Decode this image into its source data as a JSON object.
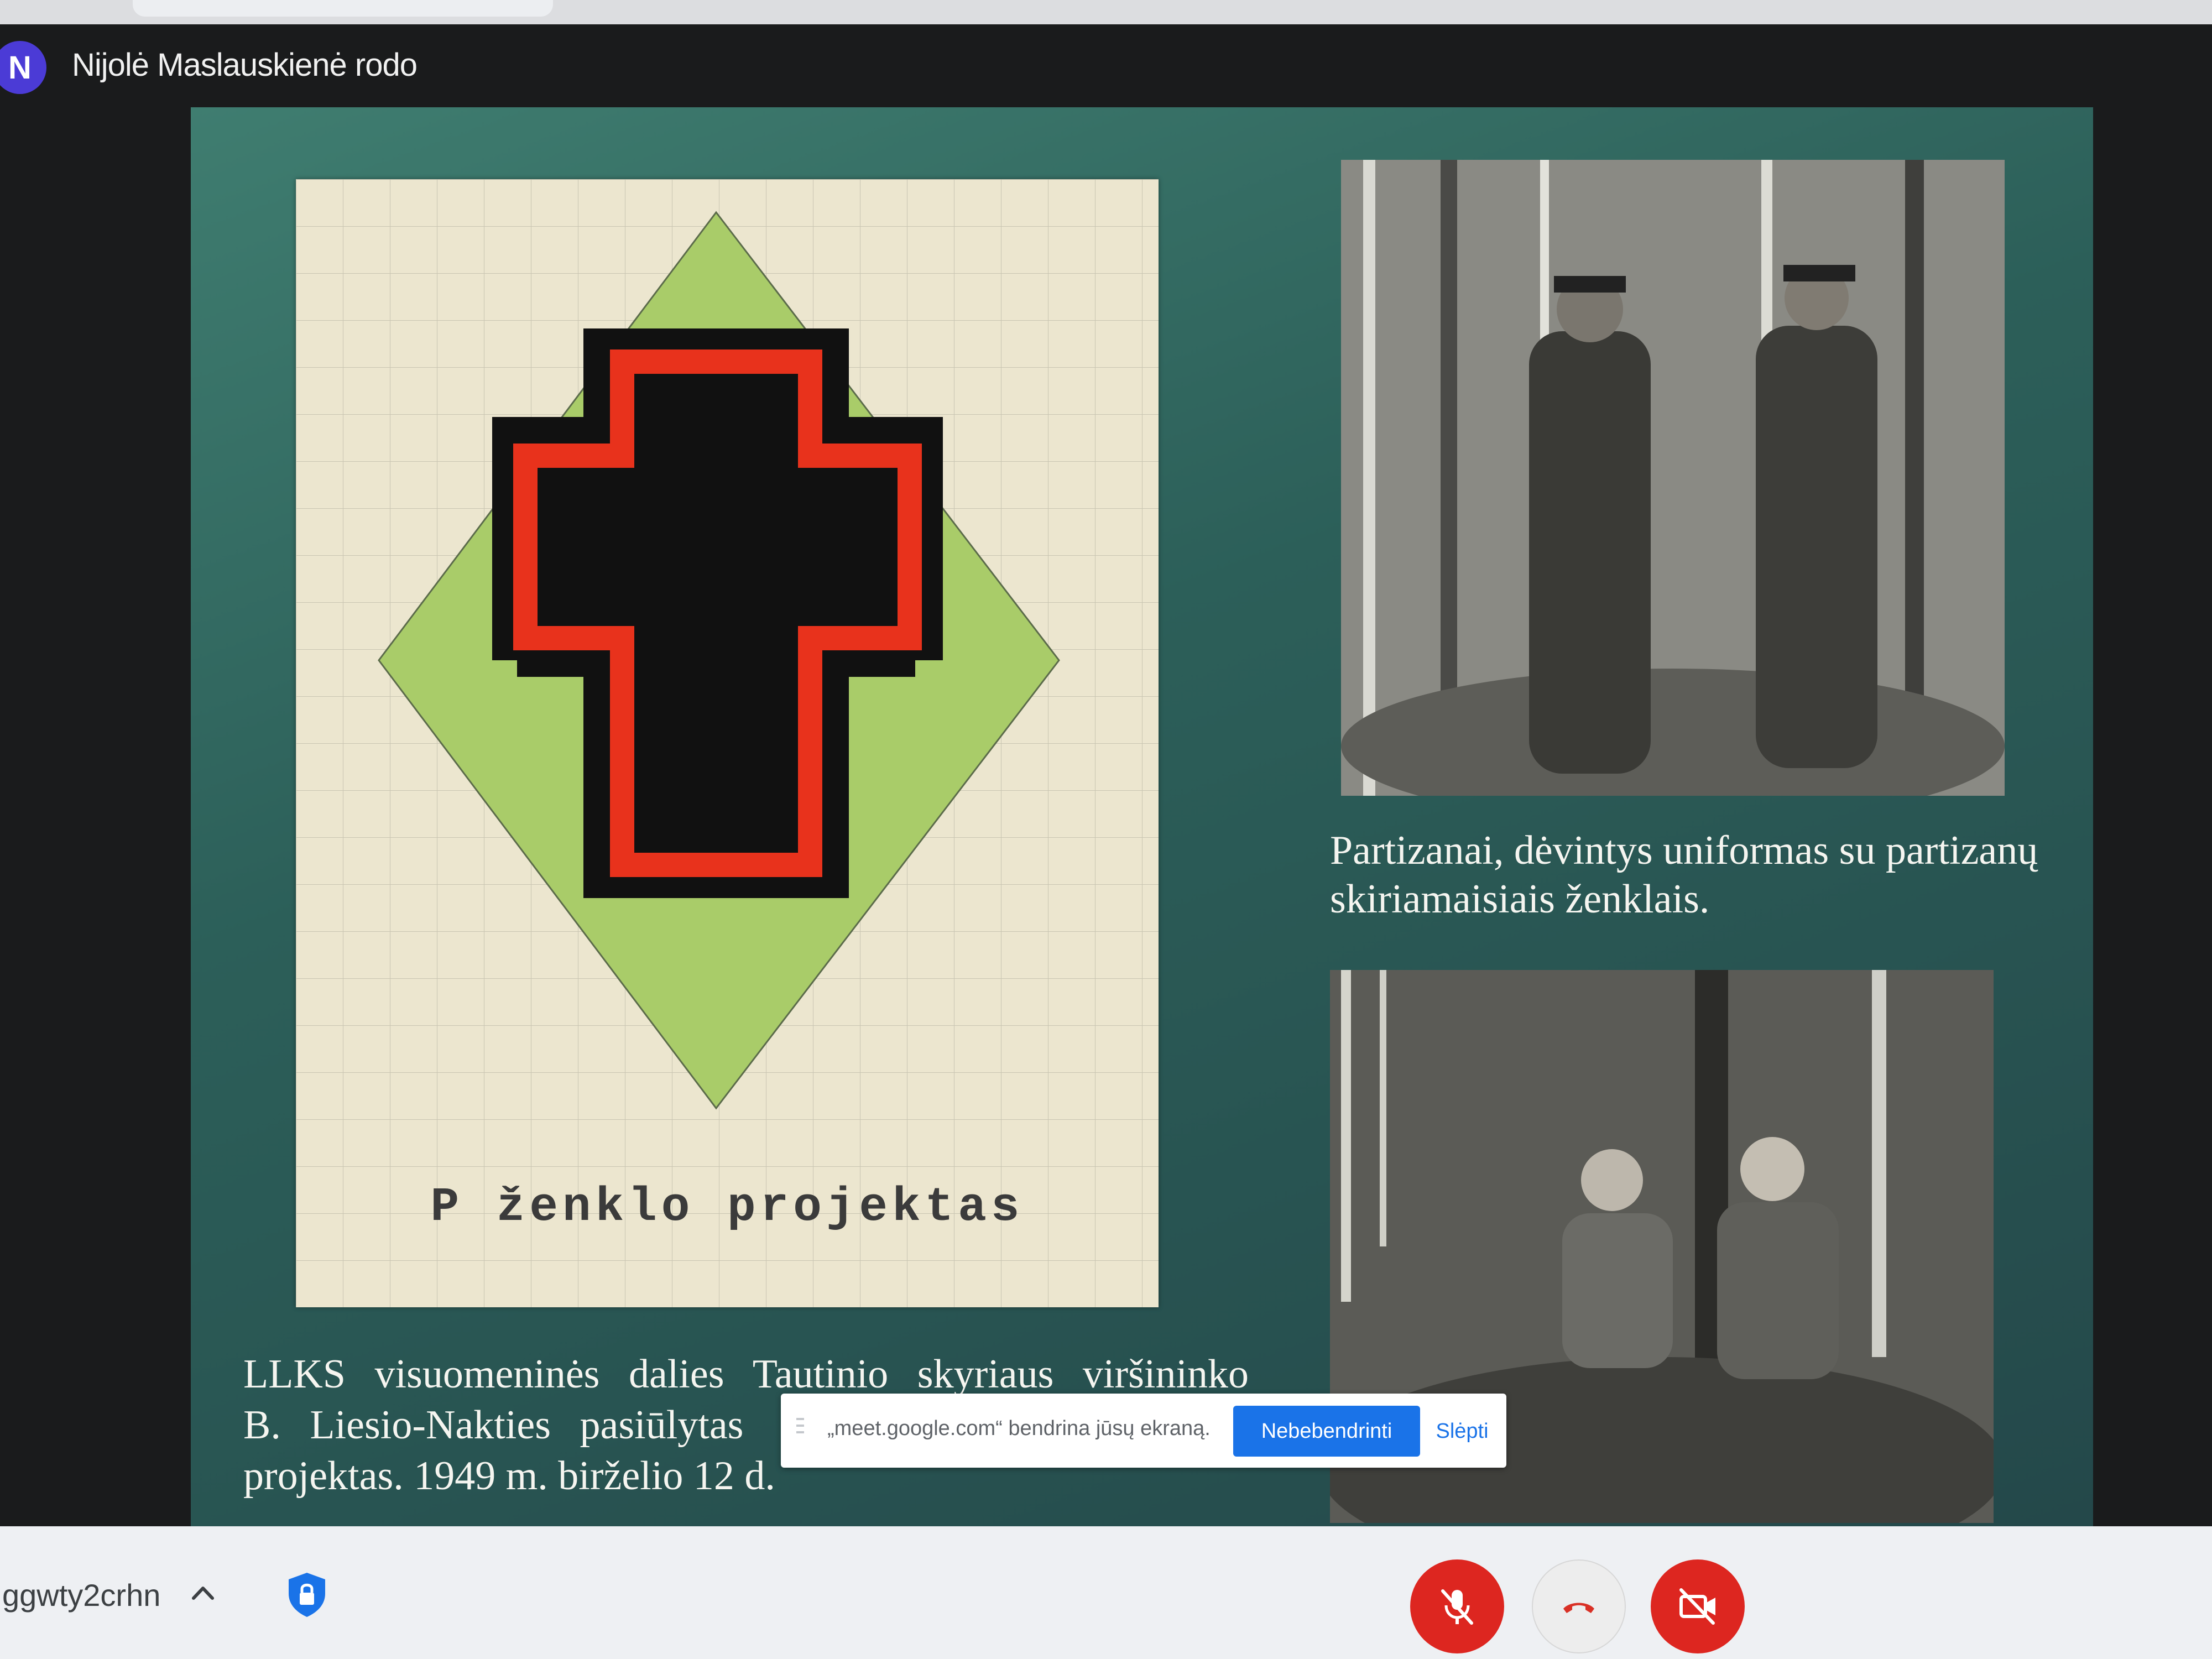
{
  "meet": {
    "presenter": {
      "avatar_initial": "N",
      "label": "Nijolė Maslauskienė rodo"
    },
    "meeting_code": "ggwty2crhn"
  },
  "slide": {
    "document_label": "P ženklo projektas",
    "caption_left": {
      "line1": "LLKS visuomeninės dalies Tautinio skyriaus viršininko",
      "line2": "B. Liesio-Nakties pasiūlytas",
      "line3": "projektas. 1949 m. birželio 12 d."
    },
    "caption_right": "Partizanai, dėvintys uniformas su partizanų skiriamaisiais ženklais."
  },
  "share_bar": {
    "message": "„meet.google.com“ bendrina jūsų ekraną.",
    "stop_label": "Nebebendrinti",
    "hide_label": "Slėpti"
  },
  "colors": {
    "accent_blue": "#1a73e8",
    "control_red": "#dd2620",
    "slide_green": "#2f6a61",
    "emblem_red": "#e8321c",
    "emblem_green": "#a9cc69"
  },
  "icons": {
    "mic": "mic-off-icon",
    "end": "call-end-icon",
    "camera": "videocam-off-icon",
    "security": "shield-lock-icon"
  }
}
